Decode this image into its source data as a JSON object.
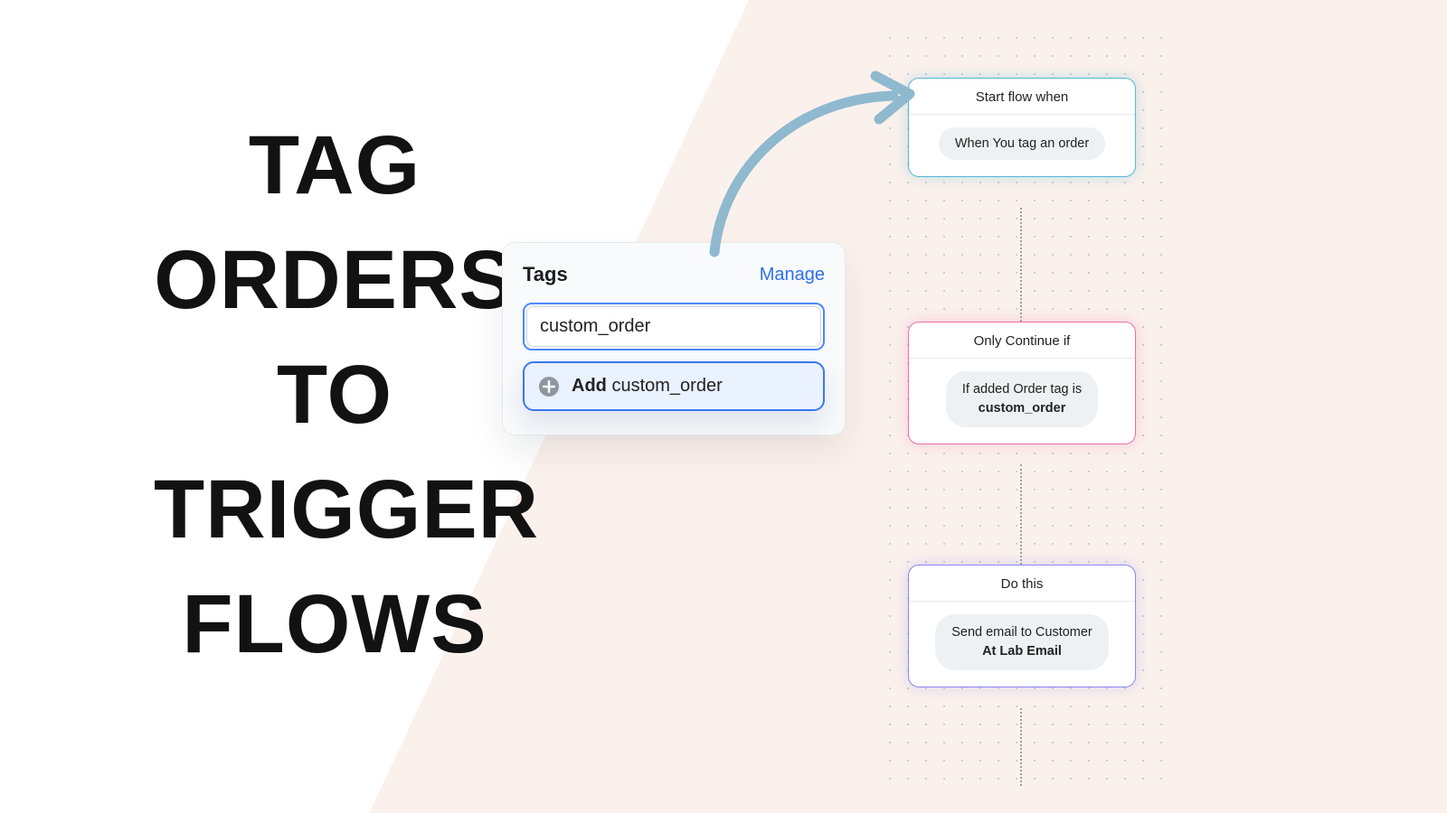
{
  "headline": {
    "line1": "TAG",
    "line2": "ORDERS",
    "line3": "TO",
    "line4": "TRIGGER",
    "line5": "FLOWS"
  },
  "tagsPanel": {
    "title": "Tags",
    "manage": "Manage",
    "inputValue": "custom_order",
    "addPrefix": "Add",
    "addValue": "custom_order"
  },
  "flow": {
    "card1": {
      "header": "Start flow when",
      "chip": "When You tag an order"
    },
    "card2": {
      "header": "Only Continue if",
      "chipLine1": "If added Order tag is",
      "chipLine2": "custom_order"
    },
    "card3": {
      "header": "Do this",
      "chipLine1": "Send email to Customer",
      "chipLine2": "At Lab Email"
    }
  },
  "icons": {
    "plus": "plus-circle",
    "arrow": "curved-arrow"
  }
}
